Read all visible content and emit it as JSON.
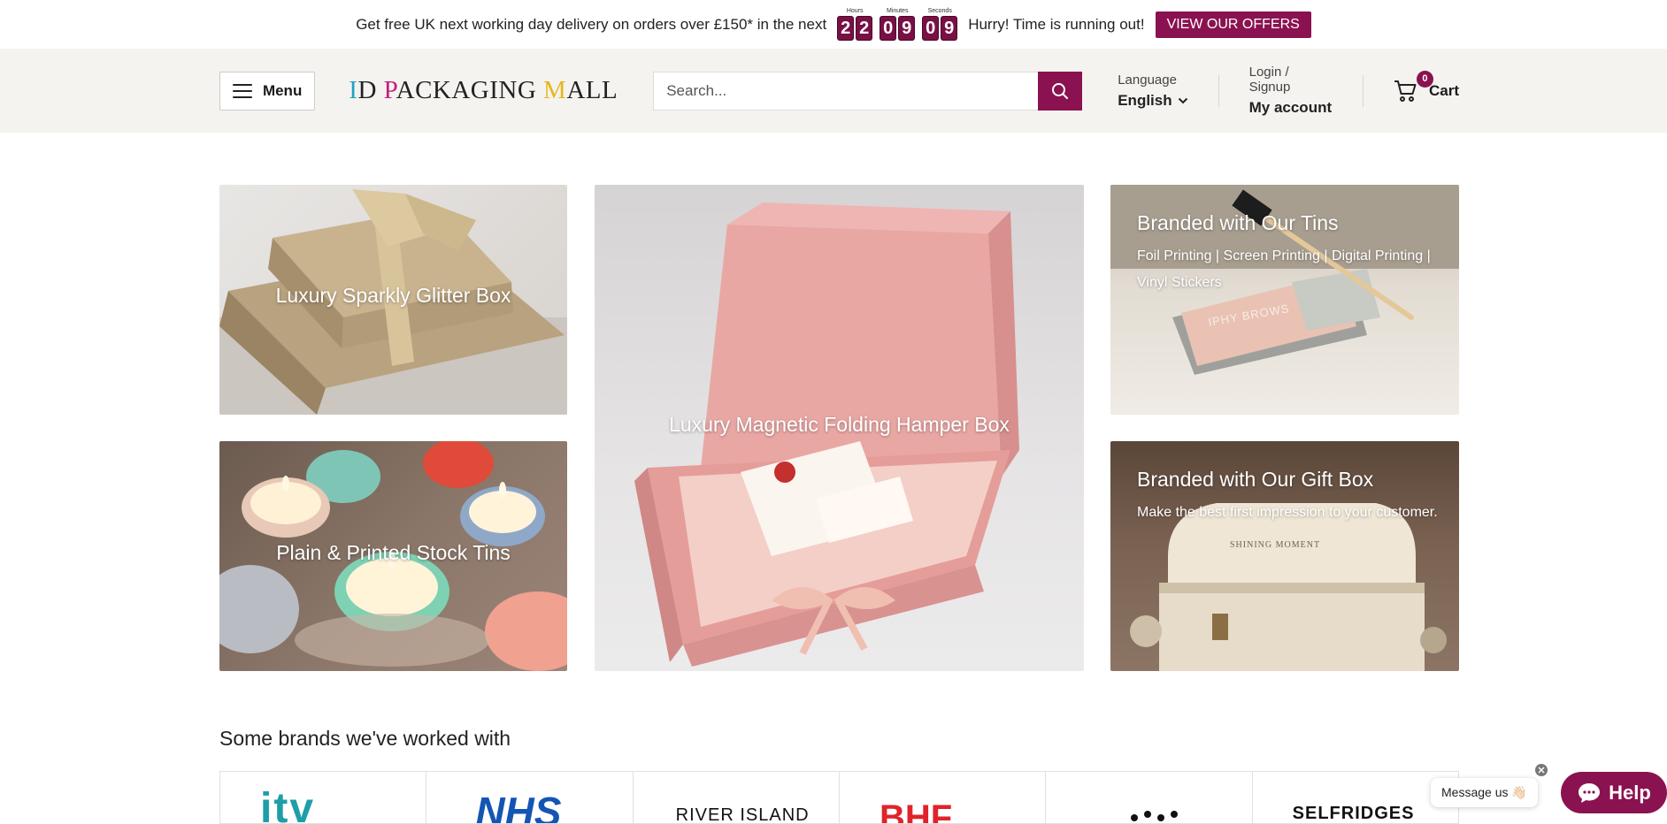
{
  "announcement": {
    "text": "Get free UK next working day delivery on orders over £150* in the next",
    "countdown": [
      {
        "label": "Hours",
        "d1": "2",
        "d2": "2"
      },
      {
        "label": "Minutes",
        "d1": "0",
        "d2": "9"
      },
      {
        "label": "Seconds",
        "d1": "0",
        "d2": "9"
      }
    ],
    "hurry": "Hurry! Time is running out!",
    "offers_button": "VIEW OUR OFFERS"
  },
  "header": {
    "menu_label": "Menu",
    "logo": {
      "part1": "I",
      "part2": "D ",
      "part3": "P",
      "part4": "ACKAGING ",
      "part5": "M",
      "part6": "ALL"
    },
    "search_placeholder": "Search...",
    "language_label": "Language",
    "language_value": "English",
    "login_label": "Login / Signup",
    "account_label": "My account",
    "cart_label": "Cart",
    "cart_count": "0"
  },
  "tiles": [
    {
      "title": "Luxury Sparkly Glitter Box"
    },
    {
      "title": "Luxury Magnetic Folding Hamper Box"
    },
    {
      "title": "Branded with Our Tins",
      "subtitle": "Foil Printing | Screen Printing | Digital Printing | Vinyl Stickers",
      "product_text": "IPHY BROWS"
    },
    {
      "title": "Plain & Printed Stock Tins"
    },
    {
      "title": "Branded with Our Gift Box",
      "subtitle": "Make the best first impression to your customer.",
      "product_text": "SHINING MOMENT"
    }
  ],
  "brands": {
    "title": "Some brands we've worked with",
    "logos": [
      "itv",
      "NHS",
      "RIVER ISLAND",
      "BHF",
      "",
      "SELFRIDGES"
    ]
  },
  "chat": {
    "message": "Message us 👋🏻",
    "help": "Help"
  },
  "colors": {
    "accent": "#8a1250",
    "header_bg": "#f5f3f0"
  }
}
